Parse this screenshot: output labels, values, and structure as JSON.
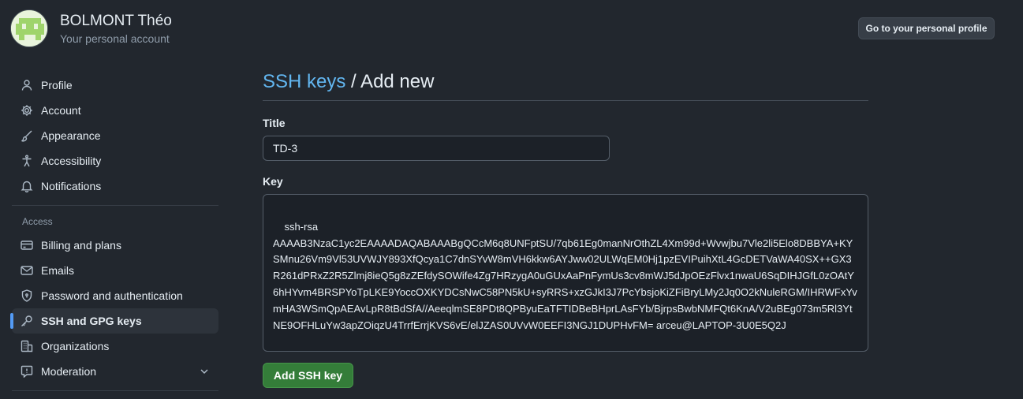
{
  "account": {
    "name": "BOLMONT Théo",
    "subtitle": "Your personal account",
    "profile_button": "Go to your personal profile"
  },
  "sidebar": {
    "items": [
      {
        "label": "Profile",
        "icon": "person-icon"
      },
      {
        "label": "Account",
        "icon": "gear-icon"
      },
      {
        "label": "Appearance",
        "icon": "paintbrush-icon"
      },
      {
        "label": "Accessibility",
        "icon": "accessibility-icon"
      },
      {
        "label": "Notifications",
        "icon": "bell-icon"
      }
    ],
    "access_section_label": "Access",
    "access_items": [
      {
        "label": "Billing and plans",
        "icon": "credit-card-icon"
      },
      {
        "label": "Emails",
        "icon": "mail-icon"
      },
      {
        "label": "Password and authentication",
        "icon": "shield-lock-icon"
      },
      {
        "label": "SSH and GPG keys",
        "icon": "key-icon",
        "active": true
      },
      {
        "label": "Organizations",
        "icon": "organization-icon"
      },
      {
        "label": "Moderation",
        "icon": "report-icon"
      }
    ]
  },
  "main": {
    "breadcrumb_link": "SSH keys",
    "breadcrumb_rest": " / Add new",
    "title_label": "Title",
    "title_value": "TD-3",
    "key_label": "Key",
    "key_value": "ssh-rsa\nAAAAB3NzaC1yc2EAAAADAQABAAABgQCcM6q8UNFptSU/7qb61Eg0manNrOthZL4Xm99d+Wvwjbu7Vle2li5Elo8DBBYA+KYSMnu26Vm9Vl53UVWJY893XfQcya1C7dnSYvW8mVH6kkw6AYJww02ULWqEM0Hj1pzEVIPuihXtL4GcDETVaWA40SX++GX3R261dPRxZ2R5Zlmj8ieQ5g8zZEfdySOWife4Zg7HRzygA0uGUxAaPnFymUs3cv8mWJ5dJpOEzFlvx1nwaU6SqDIHJGfL0zOAtY6hHYvm4BRSPYoTpLKE9YoccOXKYDCsNwC58PN5kU+syRRS+xzGJkI3J7PcYbsjoKiZFiBryLMy2Jq0O2kNuleRGM/IHRWFxYvmHA3WSmQpAEAvLpR8tBdSfA//AeeqlmSE8PDt8QPByuEaTFTIDBeBHprLAsFYb/BjrpsBwbNMFQt6KnA/V2uBEg073m5Rl3YtNE9OFHLuYw3apZOiqzU4TrrfErrjKVS6vE/elJZAS0UVvW0EEFI3NGJ1DUPHvFM= arceu@LAPTOP-3U0E5Q2J",
    "submit_button": "Add SSH key"
  },
  "colors": {
    "background": "#22272e",
    "link": "#62b6f0",
    "primary_button": "#347d39",
    "active_indicator": "#539bf5"
  }
}
